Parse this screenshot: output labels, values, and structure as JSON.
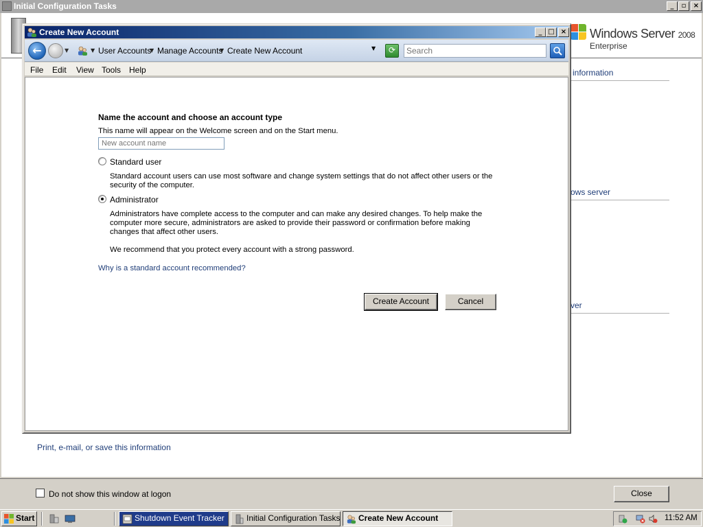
{
  "background_window": {
    "title": "Initial Configuration Tasks",
    "logo": {
      "brand": "Windows Server",
      "version": "2008",
      "edition": "Enterprise"
    },
    "links": [
      "information",
      "ows server",
      "ver"
    ],
    "print_link": "Print, e-mail, or save this information",
    "show_checkbox_label": "Do not show this window at logon",
    "close_label": "Close"
  },
  "dialog": {
    "title": "Create New Account",
    "breadcrumb": [
      "User Accounts",
      "Manage Accounts",
      "Create New Account"
    ],
    "search_placeholder": "Search",
    "menu": [
      "File",
      "Edit",
      "View",
      "Tools",
      "Help"
    ],
    "heading": "Name the account and choose an account type",
    "subtext": "This name will appear on the Welcome screen and on the Start menu.",
    "name_placeholder": "New account name",
    "options": [
      {
        "label": "Standard user",
        "selected": false,
        "description": "Standard account users can use most software and change system settings that do not affect other users or the security of the computer."
      },
      {
        "label": "Administrator",
        "selected": true,
        "description": "Administrators have complete access to the computer and can make any desired changes. To help make the computer more secure, administrators are asked to provide their password or confirmation before making changes that affect other users."
      }
    ],
    "recommendation": "We recommend that you protect every account with a strong password.",
    "why_link": "Why is a standard account recommended?",
    "create_button": "Create Account",
    "cancel_button": "Cancel"
  },
  "taskbar": {
    "start_label": "Start",
    "tasks": [
      {
        "label": "Shutdown Event Tracker"
      },
      {
        "label": "Initial Configuration Tasks"
      },
      {
        "label": "Create New Account"
      }
    ],
    "clock": "11:52 AM"
  },
  "colors": {
    "link": "#1f3d78",
    "title_active": "#0a246a",
    "title_inactive": "#a9a9a9"
  }
}
